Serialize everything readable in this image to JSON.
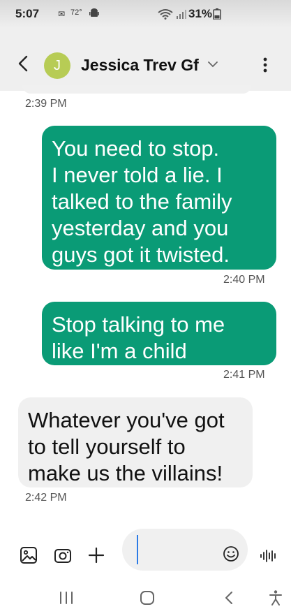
{
  "status_bar": {
    "time": "5:07",
    "temperature": "72°",
    "battery": "31%"
  },
  "header": {
    "avatar_letter": "J",
    "contact_name": "Jessica Trev Gf"
  },
  "messages": [
    {
      "direction": "timestamp",
      "text": "2:39 PM"
    },
    {
      "direction": "sent",
      "lines": [
        "You need to stop.",
        "I never told a lie. I",
        "talked to the family",
        "yesterday and you",
        "guys got it twisted."
      ]
    },
    {
      "direction": "timestamp",
      "text": "2:40 PM"
    },
    {
      "direction": "sent",
      "lines": [
        "Stop talking to me",
        "like I'm a child"
      ]
    },
    {
      "direction": "timestamp",
      "text": "2:41 PM"
    },
    {
      "direction": "received",
      "lines": [
        "Whatever you've got",
        "to tell yourself to",
        "make us the villains!"
      ]
    },
    {
      "direction": "timestamp",
      "text": "2:42 PM"
    }
  ],
  "colors": {
    "sent_bubble": "#0a9b76",
    "received_bubble": "#f0f0f0",
    "avatar": "#b7cc55",
    "cursor": "#2c7be5"
  },
  "icons": {
    "back": "chevron-left-icon",
    "contact_dropdown": "chevron-down-icon",
    "more": "more-vertical-icon",
    "gallery": "image-icon",
    "camera": "camera-icon",
    "add": "plus-icon",
    "emoji": "smile-icon",
    "voice": "voice-wave-icon",
    "nav_recents": "recents-icon",
    "nav_home": "home-icon",
    "nav_back": "back-icon",
    "nav_accessibility": "accessibility-icon"
  }
}
